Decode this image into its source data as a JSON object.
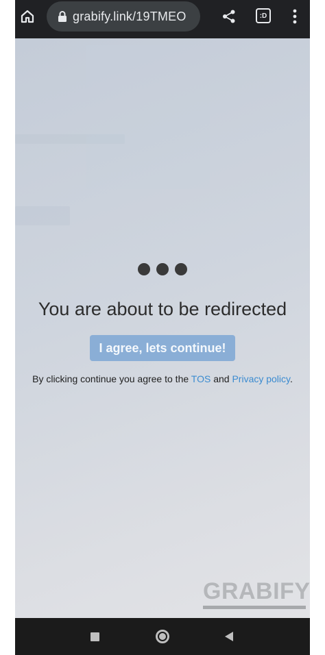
{
  "browser": {
    "url": "grabify.link/19TMEO",
    "home_icon": "home-icon",
    "lock_icon": "lock-icon",
    "share_icon": "share-icon",
    "tabs_label": ":D",
    "menu_icon": "more-vert-icon"
  },
  "page": {
    "loading_icon": "loading-dots-icon",
    "headline": "You are about to be redirected",
    "agree_button": "I agree, lets continue!",
    "disclaimer_prefix": "By clicking continue you agree to the ",
    "tos_link": "TOS",
    "disclaimer_and": " and ",
    "privacy_link": "Privacy policy",
    "disclaimer_suffix": ".",
    "brand": "GRABIFY"
  },
  "colors": {
    "toolbar_bg": "#202124",
    "url_pill_bg": "#3c4043",
    "button_bg": "#8aaed6",
    "link": "#3b8bd0",
    "navbar_bg": "#1b1b1b"
  },
  "navbar": {
    "recents_icon": "recents-square-icon",
    "home_icon": "home-circle-icon",
    "back_icon": "back-triangle-icon"
  }
}
